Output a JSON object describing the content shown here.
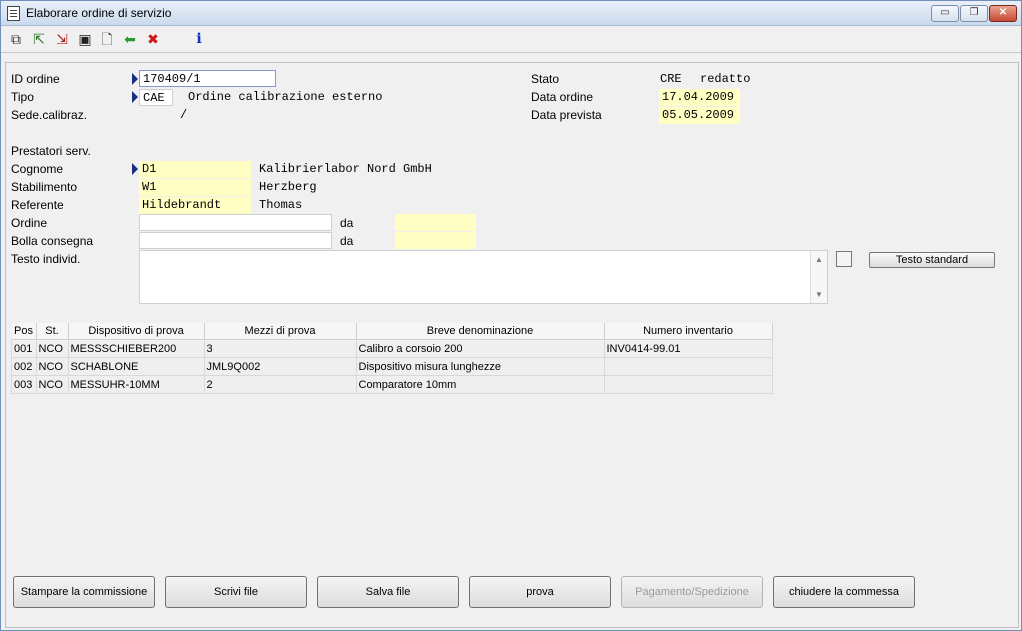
{
  "window": {
    "title": "Elaborare ordine di servizio",
    "minimize": "▭",
    "maximize": "❐",
    "close": "✕"
  },
  "toolbar": {
    "icons": [
      "copy-icon",
      "export-icon",
      "import-icon",
      "save-icon",
      "new-document-icon",
      "back-arrow-icon",
      "delete-icon",
      "info-icon"
    ],
    "glyphs": {
      "copy": "⧉",
      "export": "⇱",
      "import": "⇲",
      "save": "▣",
      "new": "🗋",
      "back": "⬅",
      "delete": "✖",
      "info": "i"
    }
  },
  "header": {
    "id_label": "ID ordine",
    "id_value": "170409/1",
    "tipo_label": "Tipo",
    "tipo_code": "CAE",
    "tipo_desc": "Ordine calibrazione esterno",
    "sede_label": "Sede.calibraz.",
    "sede_value": "/",
    "stato_label": "Stato",
    "stato_code": "CRE",
    "stato_desc": "redatto",
    "data_ordine_label": "Data ordine",
    "data_ordine_value": "17.04.2009",
    "data_prevista_label": "Data prevista",
    "data_prevista_value": "05.05.2009"
  },
  "prestatori": {
    "section_label": "Prestatori serv.",
    "cognome_label": "Cognome",
    "cognome_code": "D1",
    "cognome_name": "Kalibrierlabor Nord GmbH",
    "stabilimento_label": "Stabilimento",
    "stabilimento_code": "W1",
    "stabilimento_name": "Herzberg",
    "referente_label": "Referente",
    "referente_surname": "Hildebrandt",
    "referente_firstname": "Thomas",
    "ordine_label": "Ordine",
    "ordine_value": "",
    "ordine_da_label": "da",
    "ordine_da_value": "",
    "bolla_label": "Bolla consegna",
    "bolla_value": "",
    "bolla_da_label": "da",
    "bolla_da_value": "",
    "testo_label": "Testo individ.",
    "testo_value": "",
    "testo_standard_button": "Testo standard"
  },
  "table": {
    "columns": [
      "Pos",
      "St.",
      "Dispositivo di prova",
      "Mezzi di prova",
      "Breve denominazione",
      "Numero inventario"
    ],
    "rows": [
      [
        "001",
        "NCO",
        "MESSSCHIEBER200",
        "3",
        "Calibro a corsoio 200",
        "INV0414-99.01"
      ],
      [
        "002",
        "NCO",
        "SCHABLONE",
        "JML9Q002",
        "Dispositivo misura lunghezze",
        ""
      ],
      [
        "003",
        "NCO",
        "MESSUHR-10MM",
        "2",
        "Comparatore 10mm",
        ""
      ]
    ]
  },
  "buttons": {
    "print": "Stampare la commissione",
    "write_file": "Scrivi file",
    "save_file": "Salva file",
    "test": "prova",
    "payment": "Pagamento/Spedizione",
    "close_order": "chiudere la commessa"
  },
  "colors": {
    "accent": "#1a2f80",
    "yellow_field": "#ffffc4",
    "green_arrow": "#2a9a2a",
    "red_x": "#d01818",
    "info_blue": "#1030c0"
  }
}
